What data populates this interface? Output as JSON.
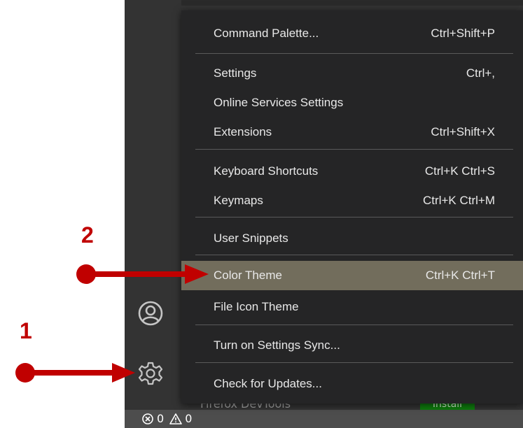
{
  "menu": {
    "items": [
      {
        "label": "Command Palette...",
        "shortcut": "Ctrl+Shift+P"
      },
      {
        "label": "Settings",
        "shortcut": "Ctrl+,"
      },
      {
        "label": "Online Services Settings",
        "shortcut": ""
      },
      {
        "label": "Extensions",
        "shortcut": "Ctrl+Shift+X"
      },
      {
        "label": "Keyboard Shortcuts",
        "shortcut": "Ctrl+K Ctrl+S"
      },
      {
        "label": "Keymaps",
        "shortcut": "Ctrl+K Ctrl+M"
      },
      {
        "label": "User Snippets",
        "shortcut": ""
      },
      {
        "label": "Color Theme",
        "shortcut": "Ctrl+K Ctrl+T"
      },
      {
        "label": "File Icon Theme",
        "shortcut": ""
      },
      {
        "label": "Turn on Settings Sync...",
        "shortcut": ""
      },
      {
        "label": "Check for Updates...",
        "shortcut": ""
      }
    ],
    "highlighted": "Color Theme"
  },
  "behind_list": {
    "item_name": "Firefox DevTools",
    "install_label": "Install"
  },
  "status_bar": {
    "errors": "0",
    "warnings": "0"
  },
  "annotations": {
    "step1": "1",
    "step2": "2"
  },
  "icons": {
    "account": "account-icon",
    "manage": "gear-icon",
    "errors": "error-circle-icon",
    "warnings": "warning-triangle-icon"
  },
  "colors": {
    "menu_bg": "#252526",
    "highlight_bg": "#726d5c",
    "annotation": "#c00000",
    "status_bar": "#4d4d4d"
  }
}
